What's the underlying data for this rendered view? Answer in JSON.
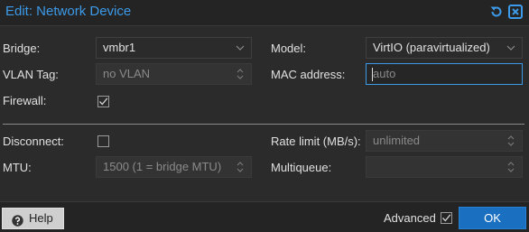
{
  "dialog": {
    "title": "Edit: Network Device"
  },
  "left": {
    "bridge_label": "Bridge:",
    "bridge_value": "vmbr1",
    "vlan_label": "VLAN Tag:",
    "vlan_placeholder": "no VLAN",
    "firewall_label": "Firewall:",
    "firewall_checked": true,
    "disconnect_label": "Disconnect:",
    "disconnect_checked": false,
    "mtu_label": "MTU:",
    "mtu_placeholder": "1500 (1 = bridge MTU)"
  },
  "right": {
    "model_label": "Model:",
    "model_value": "VirtIO (paravirtualized)",
    "mac_label": "MAC address:",
    "mac_placeholder": "auto",
    "rate_label": "Rate limit (MB/s):",
    "rate_placeholder": "unlimited",
    "multiqueue_label": "Multiqueue:",
    "multiqueue_value": ""
  },
  "footer": {
    "help_label": "Help",
    "advanced_label": "Advanced",
    "advanced_checked": true,
    "ok_label": "OK"
  },
  "colors": {
    "accent": "#3c9ae8",
    "ok_button": "#1a6fc0",
    "background": "#2b2b2b"
  },
  "icons": {
    "reset": "reset-icon",
    "close": "close-icon",
    "help": "help-icon",
    "select_trigger": "chevron-down-icon",
    "spinner_trigger": "spinner-icon",
    "check": "checkmark-icon"
  }
}
